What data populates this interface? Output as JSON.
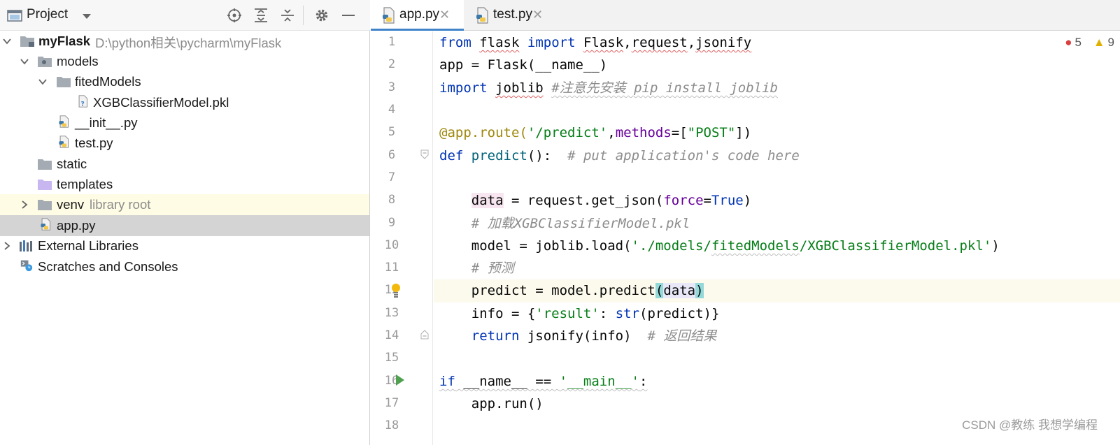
{
  "project_panel": {
    "title": "Project",
    "tree": [
      {
        "label": "myFlask",
        "hint": "D:\\python相关\\pycharm\\myFlask",
        "icon": "folder-module-icon",
        "expanded": true
      },
      {
        "label": "models",
        "icon": "folder-icon",
        "expanded": true
      },
      {
        "label": "fitedModels",
        "icon": "folder-icon",
        "expanded": true
      },
      {
        "label": "XGBClassifierModel.pkl",
        "icon": "unknown-file-icon"
      },
      {
        "label": "__init__.py",
        "icon": "python-file-icon"
      },
      {
        "label": "test.py",
        "icon": "python-file-icon"
      },
      {
        "label": "static",
        "icon": "folder-icon"
      },
      {
        "label": "templates",
        "icon": "templates-folder-icon"
      },
      {
        "label": "venv",
        "hint": "library root",
        "icon": "folder-icon",
        "expanded": false
      },
      {
        "label": "app.py",
        "icon": "python-file-icon",
        "selected": true
      },
      {
        "label": "External Libraries",
        "icon": "libraries-icon",
        "expanded": false
      },
      {
        "label": "Scratches and Consoles",
        "icon": "scratches-icon"
      }
    ]
  },
  "editor": {
    "tabs": [
      {
        "label": "app.py",
        "active": true
      },
      {
        "label": "test.py",
        "active": false
      }
    ],
    "inspections": {
      "errors": "5",
      "warnings": "9"
    },
    "line_numbers": [
      "1",
      "2",
      "3",
      "4",
      "5",
      "6",
      "7",
      "8",
      "9",
      "10",
      "11",
      "12",
      "13",
      "14",
      "15",
      "16",
      "17",
      "18"
    ],
    "current_line": 12,
    "tokens": {
      "l1": [
        "from",
        "flask",
        "import",
        "Flask",
        ",",
        "request",
        ",",
        "jsonify"
      ],
      "l2": [
        "app = Flask(__name__)"
      ],
      "l3": [
        "import",
        "joblib",
        "#注意先安装 pip install joblib"
      ],
      "l5": [
        "@app.route(",
        "'/predict'",
        ",",
        "methods",
        "=[",
        "\"POST\"",
        "])"
      ],
      "l6": [
        "def",
        "predict",
        "():  ",
        "# put application's code here"
      ],
      "l8": [
        "data",
        " = request.get_json(",
        "force",
        "=",
        "True",
        ")"
      ],
      "l9": [
        "# 加载XGBClassifierModel.pkl"
      ],
      "l10": [
        "model = joblib.load(",
        "'./models/",
        "fitedModels",
        "/XGBClassifierModel.pkl'",
        ")"
      ],
      "l11": [
        "# 预测"
      ],
      "l12": [
        "predict = model.predict",
        "(",
        "data",
        ")"
      ],
      "l13": [
        "info = {",
        "'result'",
        ": ",
        "str",
        "(predict)}"
      ],
      "l14": [
        "return",
        " jsonify(info)  ",
        "# 返回结果"
      ],
      "l16": [
        "if",
        " __name__ == ",
        "'__main__'",
        ":"
      ],
      "l17": [
        "app.run()"
      ]
    }
  },
  "watermark": "CSDN @教练 我想学编程",
  "colors": {
    "keyword": "#0033b3",
    "string": "#067d17",
    "comment": "#8c8c8c",
    "decorator": "#9e880d",
    "function": "#00627a",
    "param": "#660099",
    "selection": "#d4d4d4",
    "tab_accent": "#4083c9"
  }
}
